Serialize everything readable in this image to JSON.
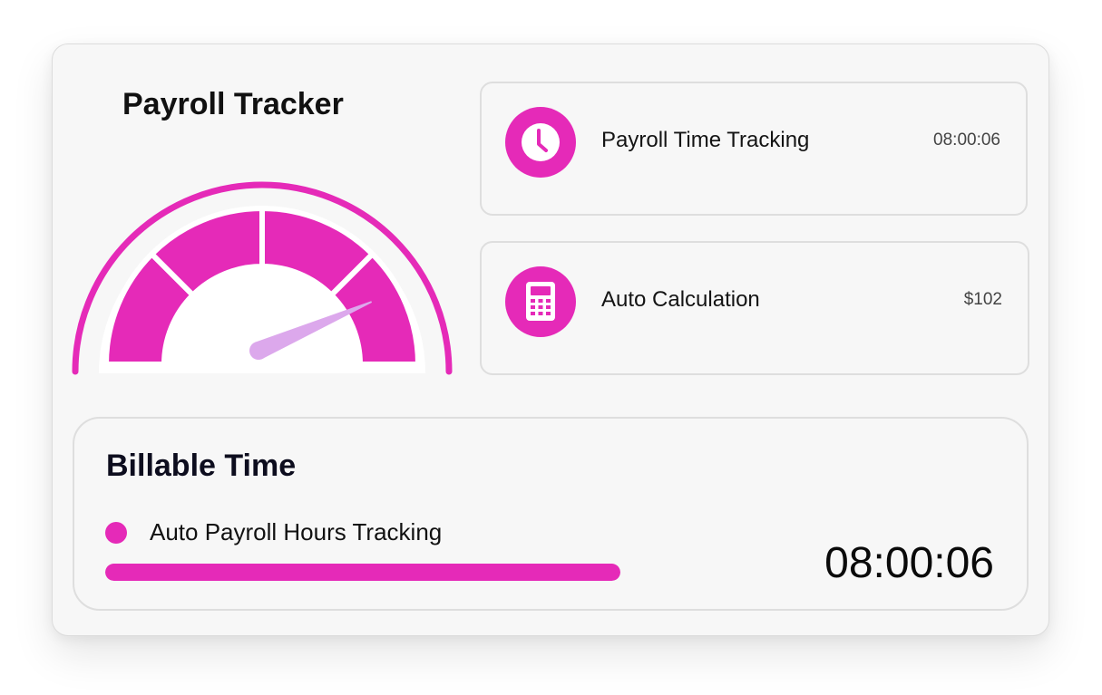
{
  "header": {
    "title": "Payroll Tracker"
  },
  "gauge": {
    "level": 0.87
  },
  "tiles": [
    {
      "icon": "clock-icon",
      "label": "Payroll Time Tracking",
      "value": "08:00:06"
    },
    {
      "icon": "calculator-icon",
      "label": "Auto Calculation",
      "value": "$102"
    }
  ],
  "billable": {
    "title": "Billable Time",
    "item_label": "Auto Payroll Hours Tracking",
    "progress": 1.0,
    "time": "08:00:06"
  },
  "colors": {
    "accent": "#e52ab8",
    "needle": "#dca8ec",
    "card_bg": "#f7f7f7",
    "border": "#dedede"
  }
}
